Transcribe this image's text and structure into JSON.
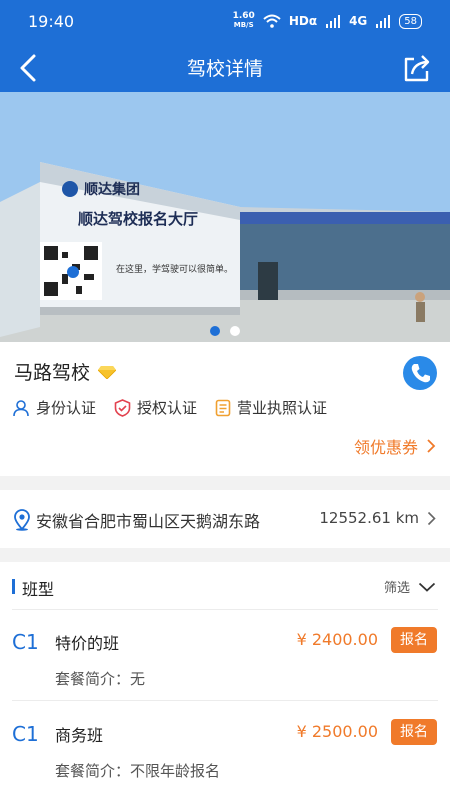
{
  "status_bar": {
    "time": "19:40",
    "net_speed": "1.60",
    "net_unit": "MB/S",
    "hd_label": "HDα",
    "signal1": "4G",
    "signal2": "4G",
    "battery": "58"
  },
  "nav": {
    "title": "驾校详情"
  },
  "banner": {
    "slide_count": 2,
    "active_slide": 1,
    "sign_group": "顺达集团",
    "sign_hall": "顺达驾校报名大厅",
    "sign_slogan": "在这里，学驾驶可以很简单。"
  },
  "school": {
    "name": "马路驾校",
    "certs": [
      {
        "label": "身份认证",
        "icon": "person-icon"
      },
      {
        "label": "授权认证",
        "icon": "shield-icon"
      },
      {
        "label": "营业执照认证",
        "icon": "license-icon"
      }
    ],
    "coupon_label": "领优惠券"
  },
  "address": {
    "text": "安徽省合肥市蜀山区天鹅湖东路",
    "distance": "12552.61 km"
  },
  "classes": {
    "section_title": "班型",
    "filter_label": "筛选",
    "items": [
      {
        "code": "C1",
        "name": "特价的班",
        "price": "¥ 2400.00",
        "enroll": "报名",
        "desc": "套餐简介：无"
      },
      {
        "code": "C1",
        "name": "商务班",
        "price": "¥ 2500.00",
        "enroll": "报名",
        "desc": "套餐简介：不限年龄报名"
      }
    ]
  },
  "colors": {
    "primary": "#1e6fd6",
    "accent": "#f07a2a",
    "phone": "#2a8ae8"
  }
}
